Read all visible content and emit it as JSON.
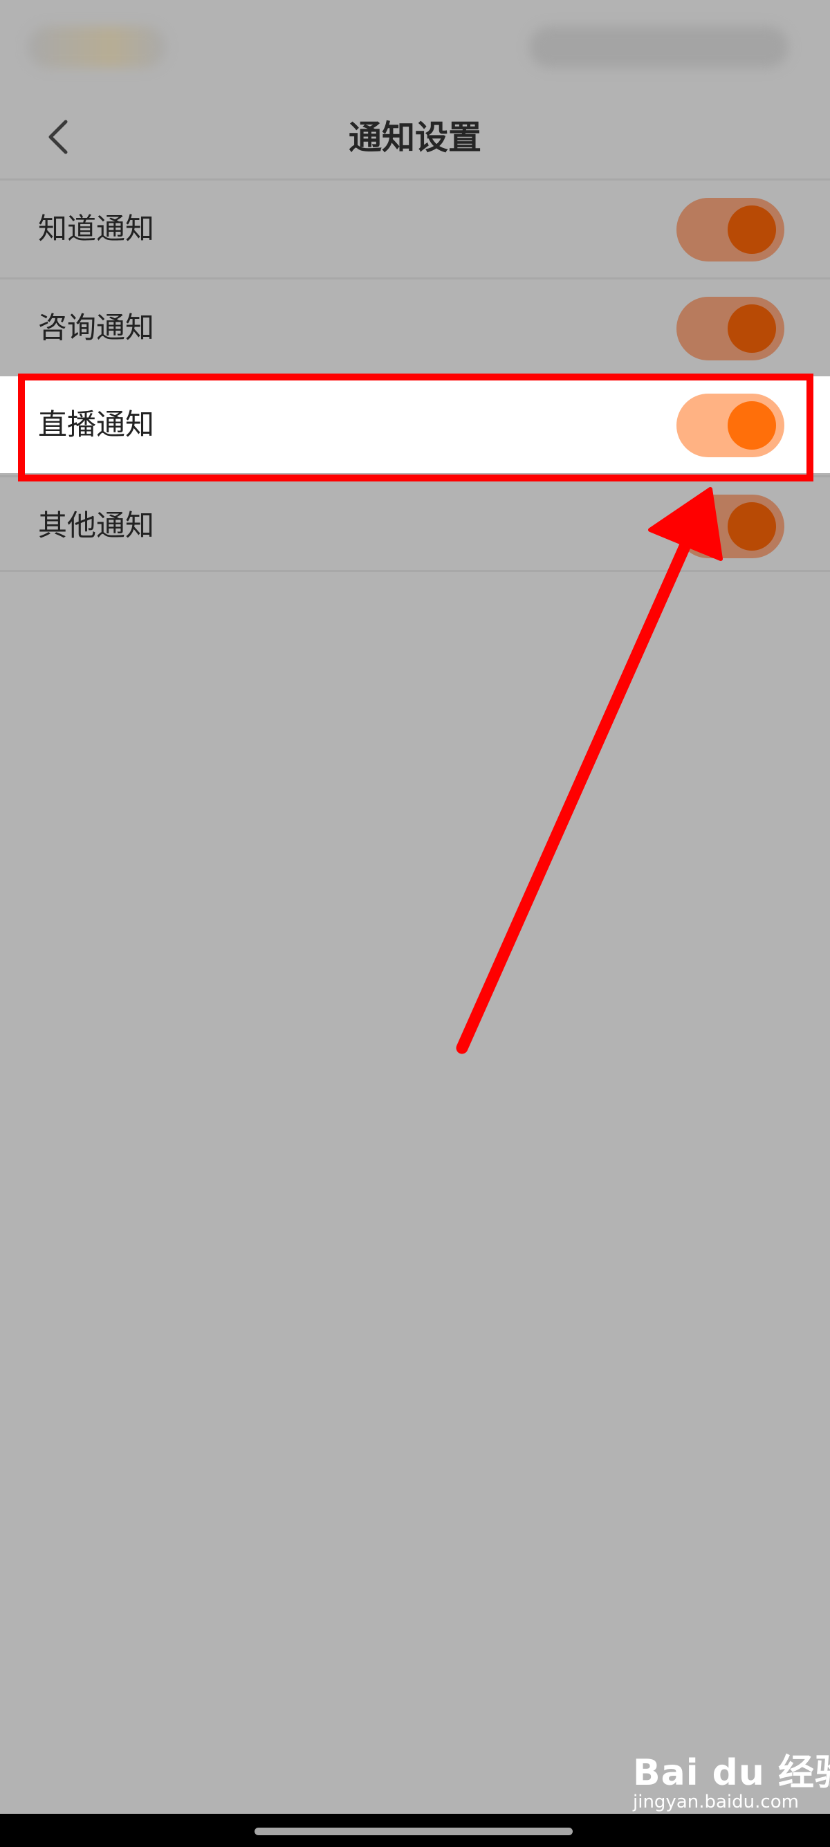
{
  "header": {
    "title": "通知设置",
    "back_icon": "chevron-left-icon"
  },
  "settings": [
    {
      "label": "知道通知",
      "enabled": true
    },
    {
      "label": "咨询通知",
      "enabled": true
    },
    {
      "label": "直播通知",
      "enabled": true
    },
    {
      "label": "其他通知",
      "enabled": true
    }
  ],
  "watermark": {
    "logo_text": "Bai du 经验",
    "url": "jingyan.baidu.com"
  },
  "colors": {
    "accent": "#ff6f0a",
    "annotation": "#ff0000"
  }
}
